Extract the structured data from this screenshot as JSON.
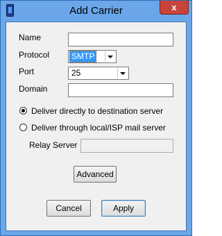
{
  "window": {
    "title": "Add Carrier",
    "close_glyph": "x"
  },
  "form": {
    "name_label": "Name",
    "name_value": "",
    "protocol_label": "Protocol",
    "protocol_value": "SMTP",
    "port_label": "Port",
    "port_value": "25",
    "domain_label": "Domain",
    "domain_value": ""
  },
  "delivery": {
    "direct_label": "Deliver directly to destination server",
    "direct_checked": true,
    "relay_label": "Deliver through local/ISP mail server",
    "relay_checked": false,
    "relay_server_label": "Relay Server",
    "relay_server_value": ""
  },
  "buttons": {
    "advanced": "Advanced",
    "cancel": "Cancel",
    "apply": "Apply"
  },
  "colors": {
    "titlebar": "#6aa6e8",
    "close_button": "#c7443a",
    "client_background": "#f0f0f0",
    "selection": "#3399ff"
  },
  "icons": {
    "app": "phone-icon",
    "close": "close-icon",
    "dropdown": "chevron-down-icon"
  }
}
